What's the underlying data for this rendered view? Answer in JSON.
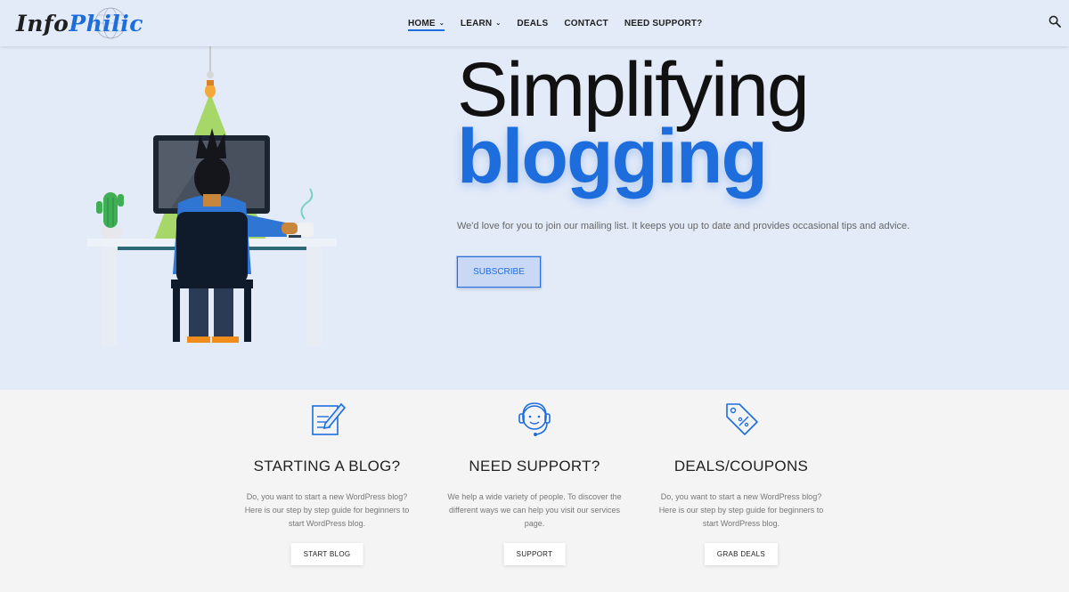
{
  "brand": {
    "part1": "Info",
    "part2": "Philic"
  },
  "nav": {
    "items": [
      {
        "label": "HOME",
        "has_caret": true,
        "active": true
      },
      {
        "label": "LEARN",
        "has_caret": true,
        "active": false
      },
      {
        "label": "DEALS",
        "has_caret": false,
        "active": false
      },
      {
        "label": "CONTACT",
        "has_caret": false,
        "active": false
      },
      {
        "label": "NEED SUPPORT?",
        "has_caret": false,
        "active": false
      }
    ],
    "caret_glyph": "⌄",
    "search_icon": "search-icon"
  },
  "hero": {
    "title_line1": "Simplifying",
    "title_line2": "blogging",
    "subtitle": "We'd love for you to join our mailing list. It keeps you up to date and provides occasional tips and advice.",
    "subscribe_label": "SUBSCRIBE"
  },
  "features": [
    {
      "icon": "edit-note-icon",
      "title": "STARTING A BLOG?",
      "description": "Do, you want to start a new WordPress blog? Here is our step by step guide for beginners to start WordPress blog.",
      "button": "START BLOG"
    },
    {
      "icon": "headset-support-icon",
      "title": "NEED SUPPORT?",
      "description": "We help a wide variety of people. To discover the different ways we can help you visit our services page.",
      "button": "SUPPORT"
    },
    {
      "icon": "discount-tag-icon",
      "title": "DEALS/COUPONS",
      "description": "Do, you want to start a new WordPress blog? Here is our step by step guide for beginners to start WordPress blog.",
      "button": "GRAB DEALS"
    }
  ],
  "colors": {
    "accent": "#1e6ddd",
    "hero_bg": "#e3ebf9",
    "page_bg": "#f4f4f4"
  }
}
